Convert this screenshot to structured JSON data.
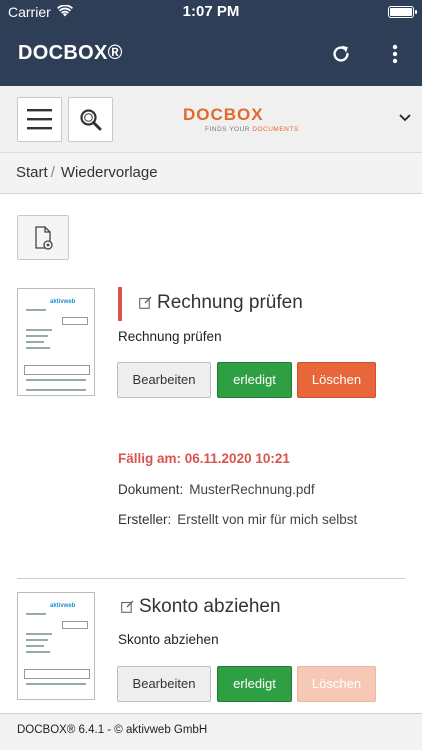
{
  "status_bar": {
    "carrier": "Carrier",
    "time": "1:07 PM"
  },
  "app": {
    "title": "DOCBOX®"
  },
  "toolbar": {
    "logo_text": "DOCBOX",
    "logo_tagline_prefix": "FINDS YOUR",
    "logo_tagline_highlight": "DOCUMENTS"
  },
  "breadcrumb": {
    "items": [
      "Start",
      "Wiedervorlage"
    ],
    "separator": "/"
  },
  "tasks": [
    {
      "title": "Rechnung prüfen",
      "subtitle": "Rechnung prüfen",
      "buttons": {
        "edit": "Bearbeiten",
        "done": "erledigt",
        "delete": "Löschen"
      },
      "due": "Fällig am: 06.11.2020 10:21",
      "document_label": "Dokument:",
      "document_value": "MusterRechnung.pdf",
      "creator_label": "Ersteller:",
      "creator_value": "Erstellt von mir für mich selbst",
      "thumbnail_brand": "aktivweb"
    },
    {
      "title": "Skonto abziehen",
      "subtitle": "Skonto abziehen",
      "buttons": {
        "edit": "Bearbeiten",
        "done": "erledigt",
        "delete": "Löschen"
      },
      "thumbnail_brand": "aktivweb"
    }
  ],
  "footer": {
    "text": "DOCBOX® 6.4.1 - © aktivweb GmbH"
  },
  "colors": {
    "header_bg": "#2e3e56",
    "accent_red": "#d9534f",
    "button_green": "#2ea043",
    "button_orange": "#e8663a",
    "logo_orange": "#e3692e"
  },
  "icons": [
    "wifi-icon",
    "battery-icon",
    "refresh-icon",
    "more-vertical-icon",
    "hamburger-menu-icon",
    "search-icon",
    "chevron-down-icon",
    "document-settings-icon",
    "edit-note-icon"
  ]
}
